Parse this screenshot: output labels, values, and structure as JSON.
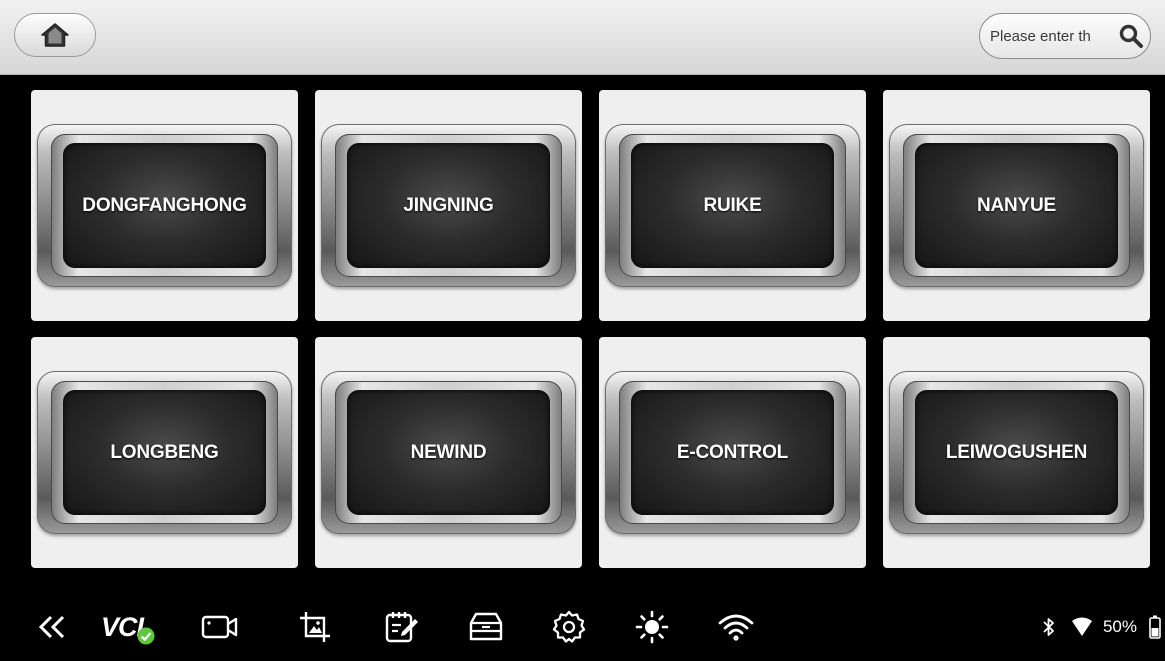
{
  "topbar": {
    "home_icon": "home-icon",
    "search": {
      "placeholder": "Please enter th",
      "value": "",
      "icon": "search-icon"
    }
  },
  "brands": [
    {
      "label": "DONGFANGHONG"
    },
    {
      "label": "JINGNING"
    },
    {
      "label": "RUIKE"
    },
    {
      "label": "NANYUE"
    },
    {
      "label": "LONGBENG"
    },
    {
      "label": "NEWIND"
    },
    {
      "label": "E-CONTROL"
    },
    {
      "label": "LEIWOGUSHEN"
    }
  ],
  "bottombar": {
    "back_icon": "double-chevron-left-icon",
    "vcl_label": "VCI",
    "vcl_status": "connected",
    "icons": [
      "video-camera-icon",
      "screenshot-crop-icon",
      "edit-notes-icon",
      "storage-drawer-icon",
      "settings-gear-icon",
      "brightness-sun-icon",
      "wifi-icon"
    ],
    "status": {
      "bluetooth_icon": "bluetooth-icon",
      "signal_icon": "wifi-signal-icon",
      "battery_text": "50%",
      "battery_icon": "battery-icon"
    }
  },
  "colors": {
    "background": "#000000",
    "tile": "#efefef",
    "topbar": "#e2e2e2",
    "vcl_badge": "#5ec83a"
  }
}
